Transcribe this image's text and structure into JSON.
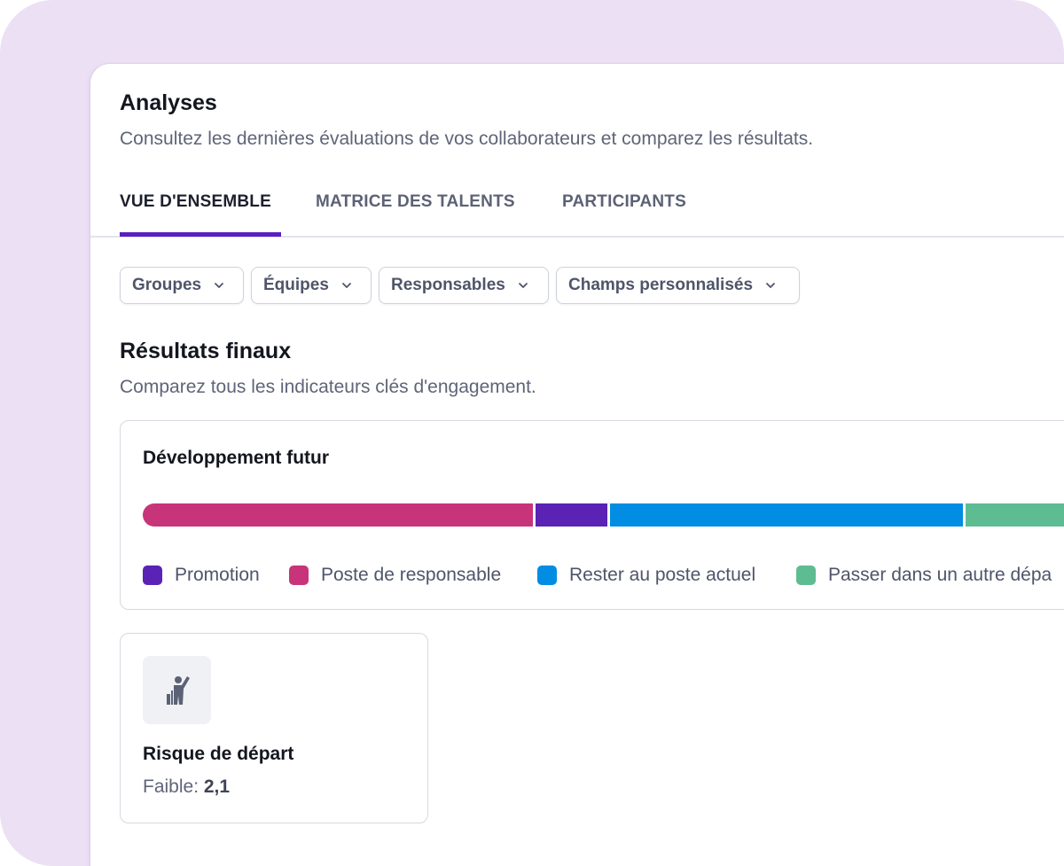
{
  "header": {
    "title": "Analyses",
    "subtitle": "Consultez les dernières évaluations de vos collaborateurs et comparez les résultats."
  },
  "tabs": [
    {
      "label": "VUE D'ENSEMBLE",
      "active": true
    },
    {
      "label": "MATRICE DES TALENTS",
      "active": false
    },
    {
      "label": "PARTICIPANTS",
      "active": false
    }
  ],
  "filters": [
    {
      "label": "Groupes"
    },
    {
      "label": "Équipes"
    },
    {
      "label": "Responsables"
    },
    {
      "label": "Champs personnalisés"
    }
  ],
  "section": {
    "title": "Résultats finaux",
    "subtitle": "Comparez tous les indicateurs clés d'engagement."
  },
  "development_card": {
    "title": "Développement futur",
    "legend": [
      {
        "label": "Promotion",
        "color": "#5a22b5"
      },
      {
        "label": "Poste de responsable",
        "color": "#c73479"
      },
      {
        "label": "Rester au poste actuel",
        "color": "#008de3"
      },
      {
        "label": "Passer dans un autre dépa",
        "color": "#5ebc93"
      }
    ],
    "bar_segments": [
      {
        "series": "Poste de responsable",
        "color": "#c73479",
        "share": 0.42
      },
      {
        "series": "Promotion",
        "color": "#5a22b5",
        "share": 0.08
      },
      {
        "series": "Rester au poste actuel",
        "color": "#008de3",
        "share": 0.38
      },
      {
        "series": "Passer dans un autre dépa",
        "color": "#5ebc93",
        "share": 0.12
      }
    ]
  },
  "risk_card": {
    "icon": "person-waving-icon",
    "title": "Risque de départ",
    "value_label": "Faible:",
    "value": "2,1"
  },
  "colors": {
    "accent": "#5a1fc0",
    "background": "#ece0f4"
  }
}
